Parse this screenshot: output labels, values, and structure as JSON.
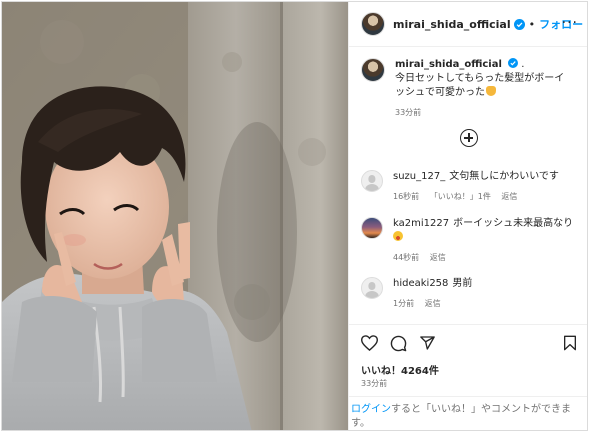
{
  "header": {
    "username": "mirai_shida_official",
    "separator": "•",
    "follow_label": "フォロー",
    "more_label": "···"
  },
  "caption": {
    "username": "mirai_shida_official",
    "suffix": ".",
    "text_line1": "今日セットしてもらった髪型がボーイ",
    "text_line2": "ッシュで可愛かった",
    "time": "33分前"
  },
  "comments": [
    {
      "username": "suzu_127_",
      "text": "文句無しにかわいいです",
      "time": "16秒前",
      "likes": "「いいね！」1件",
      "reply": "返信"
    },
    {
      "username": "ka2mi1227",
      "text": "ボーイッシュ未来最高なり",
      "time": "44秒前",
      "reply": "返信"
    },
    {
      "username": "hideaki258",
      "text": "男前",
      "time": "1分前",
      "reply": "返信"
    }
  ],
  "footer": {
    "likes": "いいね！4264件",
    "time": "33分前",
    "login_link": "ログイン",
    "login_text_line1": "すると「いいね！」やコメントができま",
    "login_text_line2": "す。"
  },
  "icons": {
    "header_avatar": "profile-avatar-icon",
    "verified": "verified-badge-icon",
    "load_more": "plus-circle-icon",
    "like": "heart-icon",
    "comment": "comment-bubble-icon",
    "share": "paper-plane-icon",
    "save": "bookmark-icon"
  },
  "colors": {
    "accent": "#0095f6",
    "text": "#262626",
    "muted": "#737373",
    "border": "#efefef"
  }
}
